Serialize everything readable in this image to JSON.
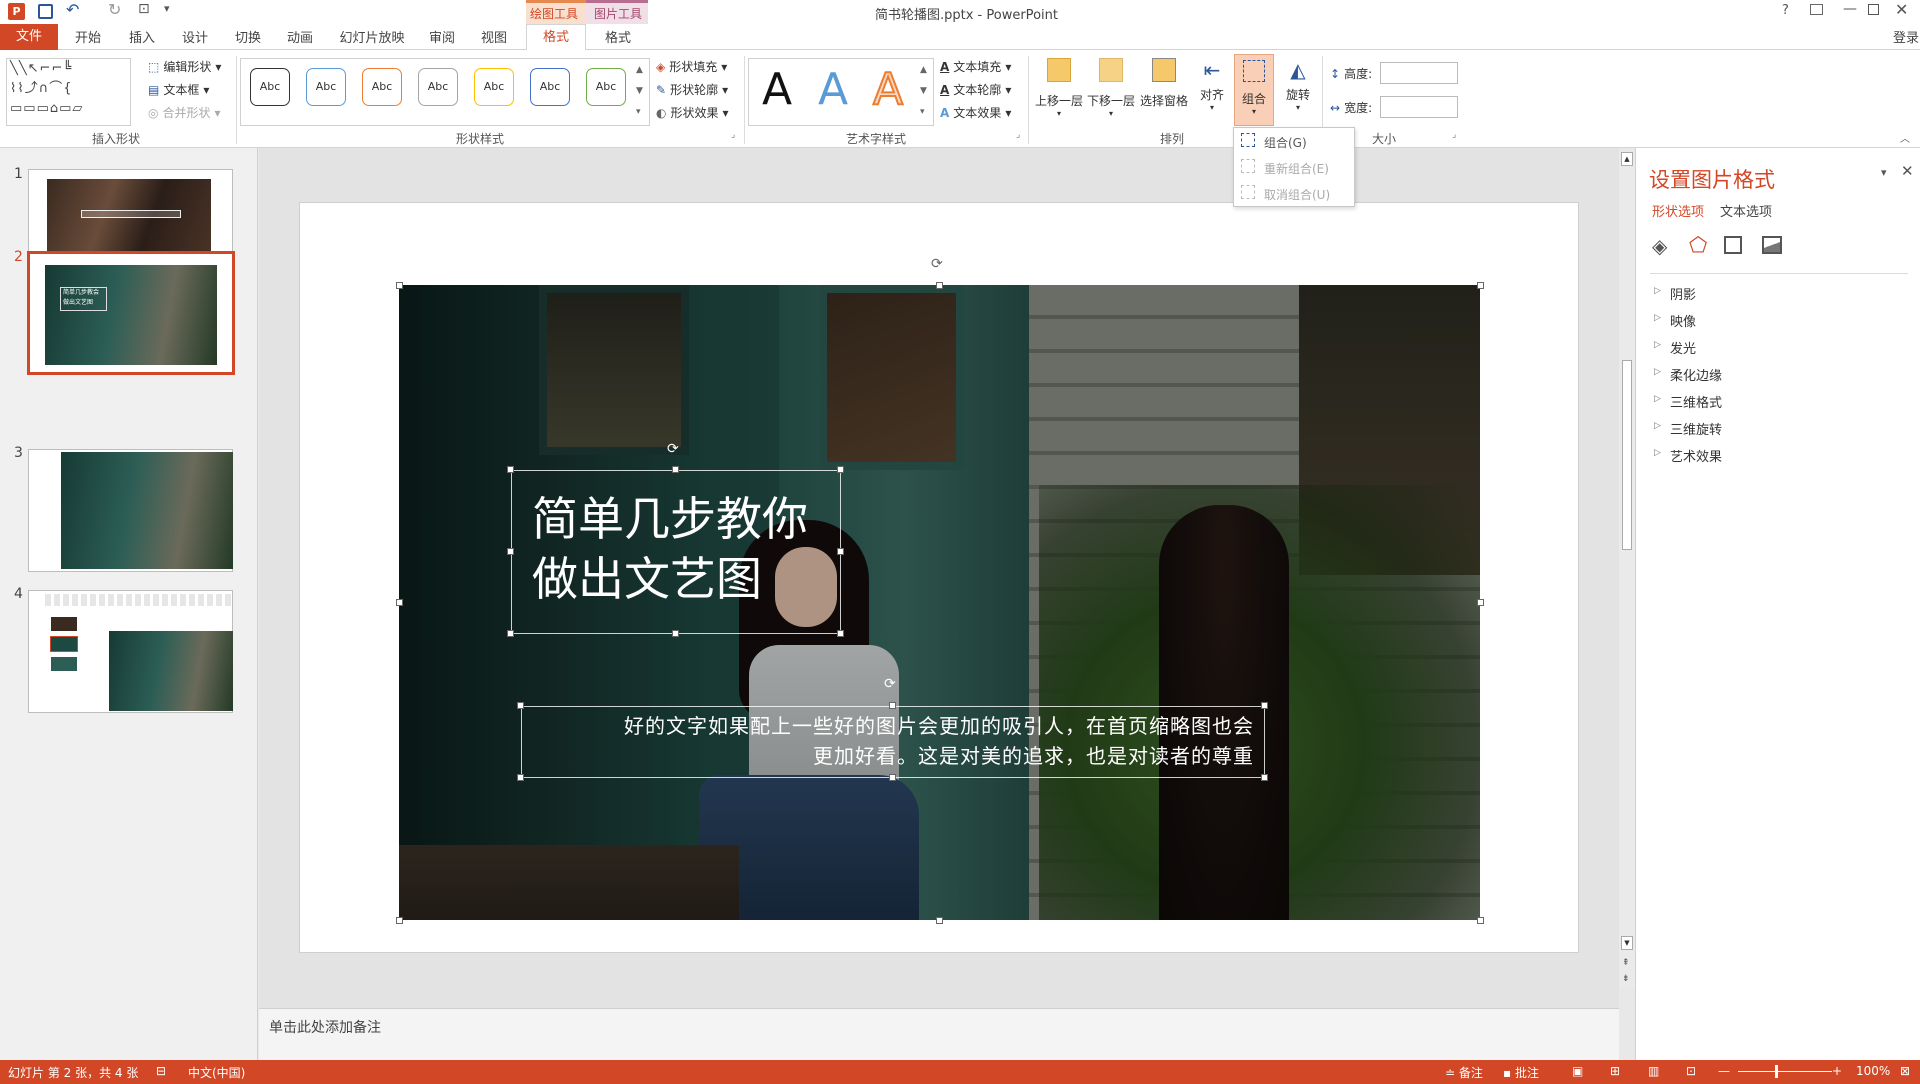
{
  "window": {
    "title": "简书轮播图.pptx - PowerPoint",
    "help": "?",
    "login": "登录"
  },
  "context_tabs": {
    "drawing_tools": "绘图工具",
    "picture_tools": "图片工具",
    "format1": "格式",
    "format2": "格式"
  },
  "tabs": [
    "文件",
    "开始",
    "插入",
    "设计",
    "切换",
    "动画",
    "幻灯片放映",
    "审阅",
    "视图"
  ],
  "ribbon": {
    "insert_shapes": {
      "label": "插入形状",
      "edit_shape": "编辑形状",
      "text_box": "文本框",
      "merge_shapes": "合并形状"
    },
    "shape_styles": {
      "label": "形状样式",
      "fill": "形状填充",
      "outline": "形状轮廓",
      "effects": "形状效果",
      "abc": [
        "Abc",
        "Abc",
        "Abc",
        "Abc",
        "Abc",
        "Abc",
        "Abc"
      ]
    },
    "wordart": {
      "label": "艺术字样式",
      "fill": "文本填充",
      "outline": "文本轮廓",
      "effects": "文本效果",
      "glyph": "A"
    },
    "arrange": {
      "label": "排列",
      "bring_forward": "上移一层",
      "send_backward": "下移一层",
      "selection_pane": "选择窗格",
      "align": "对齐",
      "group": "组合",
      "rotate": "旋转"
    },
    "size": {
      "label": "大小",
      "height_label": "高度:",
      "width_label": "宽度:",
      "height_value": "",
      "width_value": ""
    }
  },
  "group_menu": {
    "items": [
      "组合(G)",
      "重新组合(E)",
      "取消组合(U)"
    ]
  },
  "slides": {
    "numbers": [
      "1",
      "2",
      "3",
      "4"
    ],
    "selected": "2"
  },
  "slide": {
    "title_line1": "简单几步教你",
    "title_line2": "做出文艺图",
    "body_line1": "好的文字如果配上一些好的图片会更加的吸引人，在首页缩略图也会",
    "body_line2": "更加好看。这是对美的追求，也是对读者的尊重"
  },
  "thumb2": {
    "line1": "简单几步教会",
    "line2": "做出文艺图"
  },
  "notes_placeholder": "单击此处添加备注",
  "format_pane": {
    "title": "设置图片格式",
    "tab_shape": "形状选项",
    "tab_text": "文本选项",
    "sections": [
      "阴影",
      "映像",
      "发光",
      "柔化边缘",
      "三维格式",
      "三维旋转",
      "艺术效果"
    ]
  },
  "status": {
    "slide_info": "幻灯片 第 2 张，共 4 张",
    "language": "中文(中国)",
    "notes": "备注",
    "comments": "批注",
    "zoom": "100%"
  },
  "colors": {
    "accent": "#d24726",
    "selected_tab": "#c43e1c",
    "context_tab": "#f3b78e"
  }
}
